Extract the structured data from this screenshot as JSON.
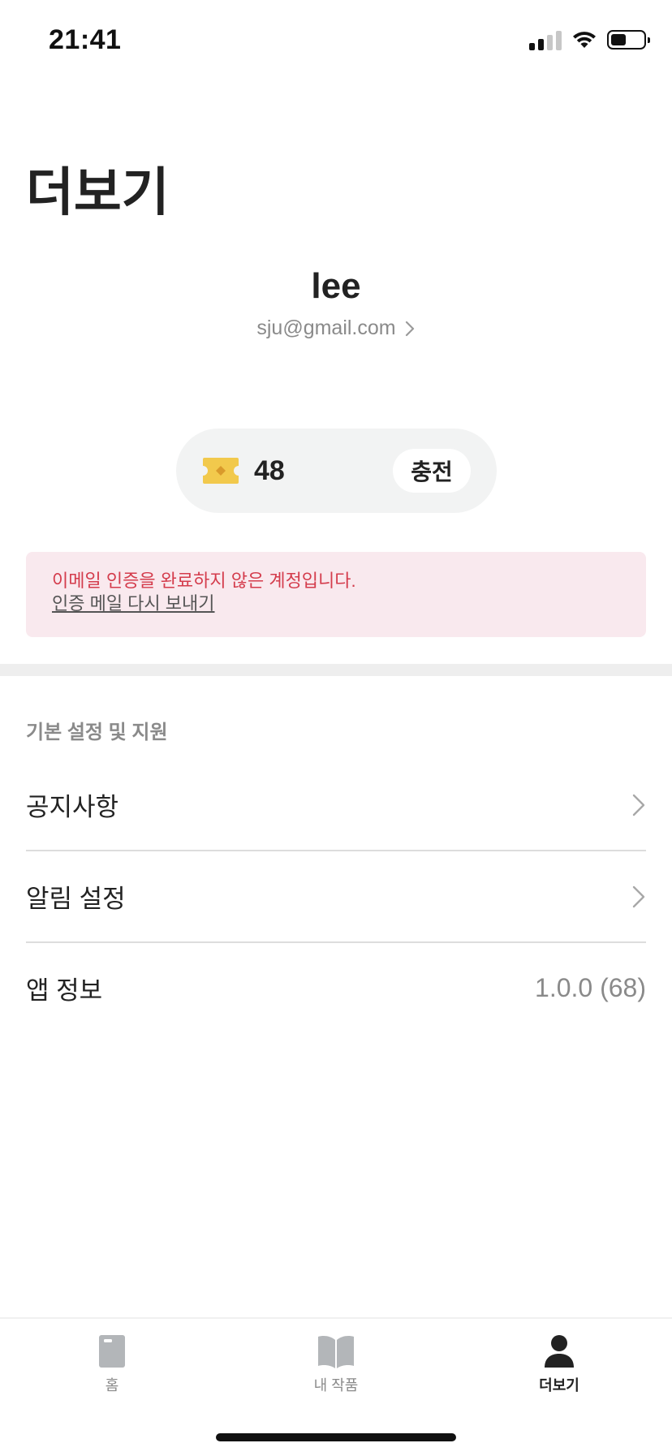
{
  "status_bar": {
    "time": "21:41"
  },
  "page": {
    "title": "더보기"
  },
  "profile": {
    "name": "lee",
    "email": "sju@gmail.com"
  },
  "tickets": {
    "count": "48",
    "charge_label": "충전"
  },
  "alert": {
    "message": "이메일 인증을 완료하지 않은 계정입니다.",
    "resend_link": "인증 메일 다시 보내기"
  },
  "settings": {
    "section_title": "기본 설정 및 지원",
    "items": [
      {
        "label": "공지사항"
      },
      {
        "label": "알림 설정"
      },
      {
        "label": "앱 정보",
        "value": "1.0.0 (68)"
      }
    ]
  },
  "tab_bar": {
    "tabs": [
      {
        "label": "홈",
        "icon": "home-icon"
      },
      {
        "label": "내 작품",
        "icon": "open-book-icon"
      },
      {
        "label": "더보기",
        "icon": "person-icon",
        "active": true
      }
    ]
  },
  "colors": {
    "alert_text": "#d43c4c",
    "alert_background": "#f9e9ee",
    "ticket_gold": "#f2c94c",
    "pill_background": "#f2f3f3"
  }
}
